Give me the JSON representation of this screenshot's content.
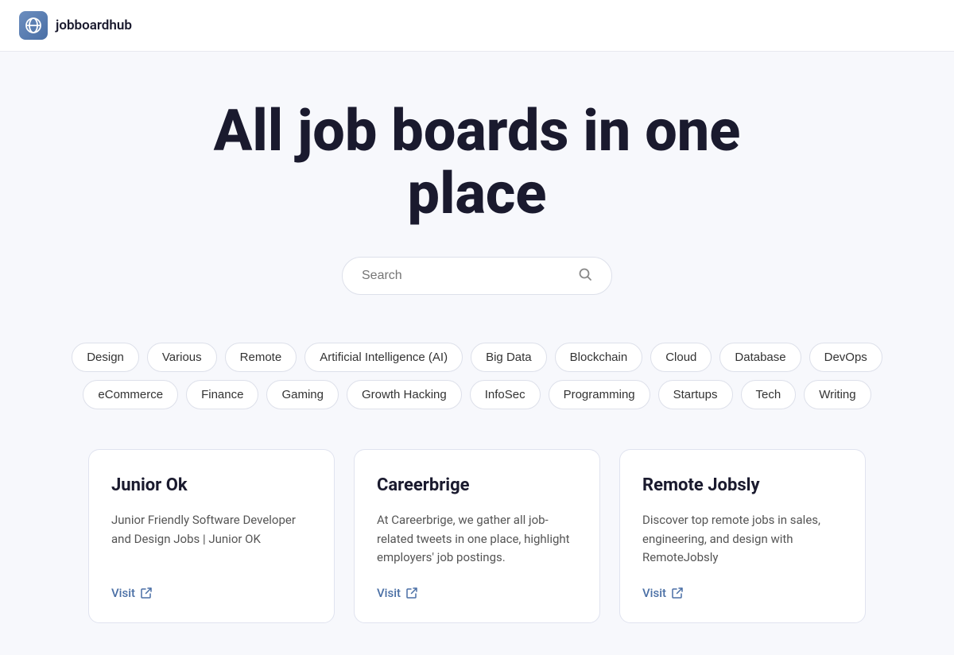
{
  "header": {
    "logo_alt": "jobboardhub logo",
    "logo_text": "jobboardhub",
    "logo_emoji": "🌐"
  },
  "hero": {
    "title": "All job boards in one place",
    "search_placeholder": "Search"
  },
  "tags": [
    "Design",
    "Various",
    "Remote",
    "Artificial Intelligence (AI)",
    "Big Data",
    "Blockchain",
    "Cloud",
    "Database",
    "DevOps",
    "eCommerce",
    "Finance",
    "Gaming",
    "Growth Hacking",
    "InfoSec",
    "Programming",
    "Startups",
    "Tech",
    "Writing"
  ],
  "cards": [
    {
      "title": "Junior Ok",
      "description": "Junior Friendly Software Developer and Design Jobs | Junior OK",
      "visit_label": "Visit"
    },
    {
      "title": "Careerbrige",
      "description": "At Careerbrige, we gather all job-related tweets in one place, highlight employers' job postings.",
      "visit_label": "Visit"
    },
    {
      "title": "Remote Jobsly",
      "description": "Discover top remote jobs in sales, engineering, and design with RemoteJobsly",
      "visit_label": "Visit"
    }
  ]
}
